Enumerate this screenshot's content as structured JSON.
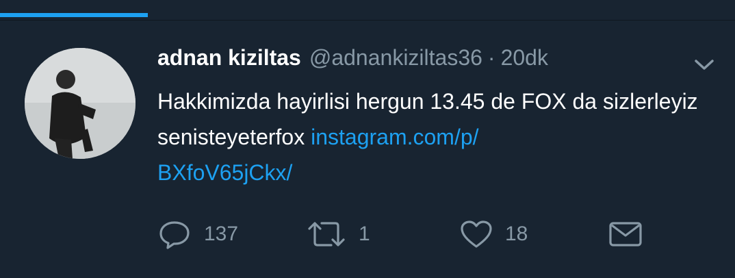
{
  "tweet": {
    "display_name": "adnan kiziltas",
    "handle": "@adnankiziltas36",
    "separator": "·",
    "time": "20dk",
    "text": "Hakkimizda hayirlisi hergun 13.45 de FOX da sizlerleyiz senisteyeterfox ",
    "link_line1": "instagram.com/p/",
    "link_line2": "BXfoV65jCkx/"
  },
  "actions": {
    "reply_count": "137",
    "retweet_count": "1",
    "like_count": "18"
  },
  "icons": {
    "reply": "reply-icon",
    "retweet": "retweet-icon",
    "like": "heart-icon",
    "message": "mail-icon",
    "more": "chevron-down-icon"
  },
  "colors": {
    "background": "#182431",
    "accent": "#1da1f2",
    "muted": "#8899a6",
    "text": "#ffffff"
  }
}
